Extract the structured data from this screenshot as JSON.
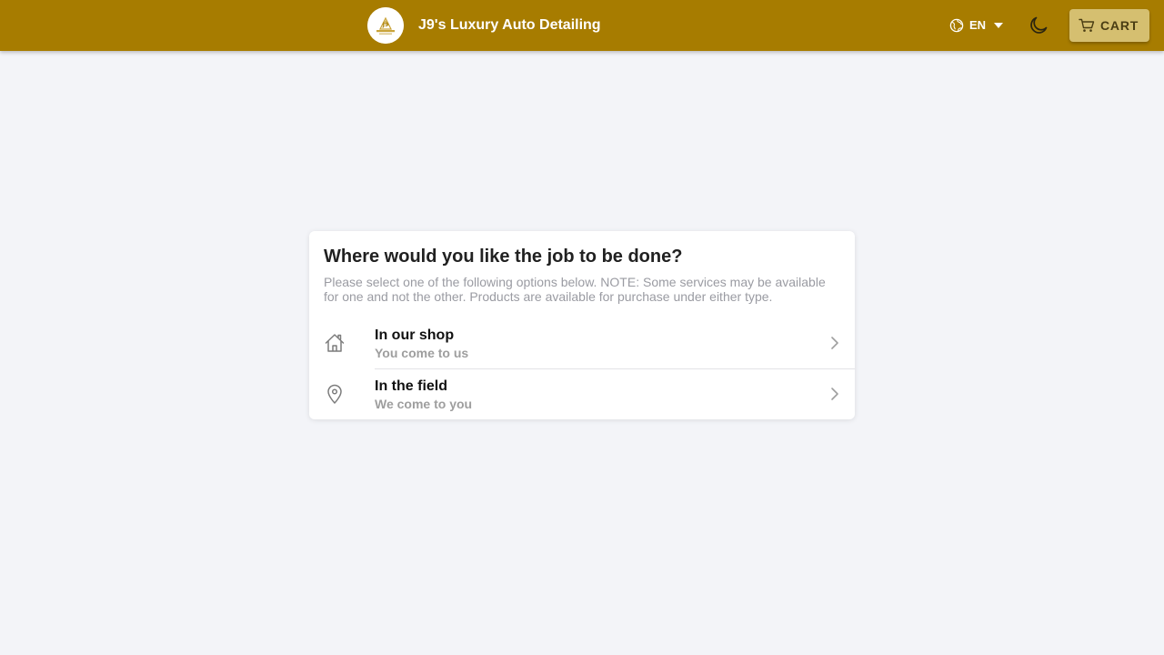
{
  "header": {
    "brand_name": "J9's Luxury Auto Detailing",
    "language": {
      "code": "EN",
      "icon": "globe-icon"
    },
    "theme_toggle_icon": "moon-icon",
    "cart": {
      "label": "CART",
      "icon": "cart-icon"
    }
  },
  "location_dialog": {
    "title": "Where would you like the job to be done?",
    "description": "Please select one of the following options below. NOTE: Some services may be available for one and not the other. Products are available for purchase under either type.",
    "options": [
      {
        "title": "In our shop",
        "subtitle": "You come to us",
        "icon": "home-icon"
      },
      {
        "title": "In the field",
        "subtitle": "We come to you",
        "icon": "map-pin-icon"
      }
    ]
  },
  "colors": {
    "header_bg": "#a77c00",
    "cart_button_bg": "#d5bf70",
    "page_bg": "#f3f4f8",
    "card_bg": "#ffffff",
    "muted_text": "#9a9ba2"
  }
}
